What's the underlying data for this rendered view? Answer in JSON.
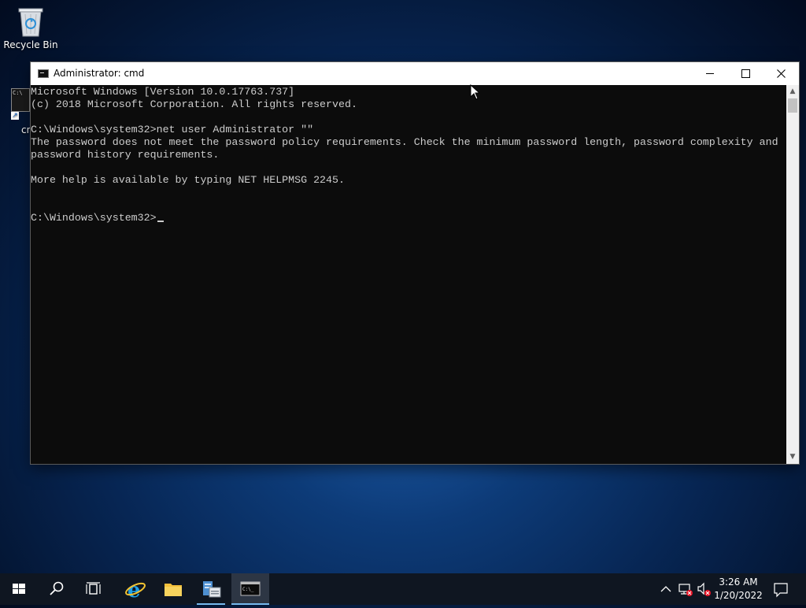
{
  "desktop": {
    "icons": [
      {
        "label": "Recycle Bin",
        "icon": "recycle-bin-icon"
      },
      {
        "label": "cm",
        "icon": "cmd-shortcut-icon"
      }
    ]
  },
  "window": {
    "title": "Administrator: cmd",
    "icon": "cmd-icon",
    "controls": {
      "minimize": "minimize-icon",
      "maximize": "maximize-icon",
      "close": "close-icon"
    }
  },
  "console": {
    "lines": [
      "Microsoft Windows [Version 10.0.17763.737]",
      "(c) 2018 Microsoft Corporation. All rights reserved.",
      "",
      "C:\\Windows\\system32>net user Administrator \"\"",
      "The password does not meet the password policy requirements. Check the minimum password length, password complexity and",
      "password history requirements.",
      "",
      "More help is available by typing NET HELPMSG 2245.",
      "",
      ""
    ],
    "prompt": "C:\\Windows\\system32>",
    "colors": {
      "background": "#0c0c0c",
      "text": "#cccccc"
    }
  },
  "taskbar": {
    "items": [
      {
        "name": "start",
        "icon": "windows-logo-icon"
      },
      {
        "name": "search",
        "icon": "search-icon"
      },
      {
        "name": "task-view",
        "icon": "task-view-icon"
      },
      {
        "name": "internet-explorer",
        "icon": "internet-explorer-icon"
      },
      {
        "name": "file-explorer",
        "icon": "folder-icon"
      },
      {
        "name": "server-manager",
        "icon": "server-manager-icon"
      },
      {
        "name": "cmd",
        "icon": "cmd-icon",
        "active": true
      }
    ],
    "tray": {
      "icons": [
        "chevron-up-icon",
        "network-error-icon",
        "volume-muted-icon"
      ],
      "time": "3:26 AM",
      "date": "1/20/2022",
      "notification": "action-center-icon"
    },
    "accent": "#76b9ed"
  }
}
